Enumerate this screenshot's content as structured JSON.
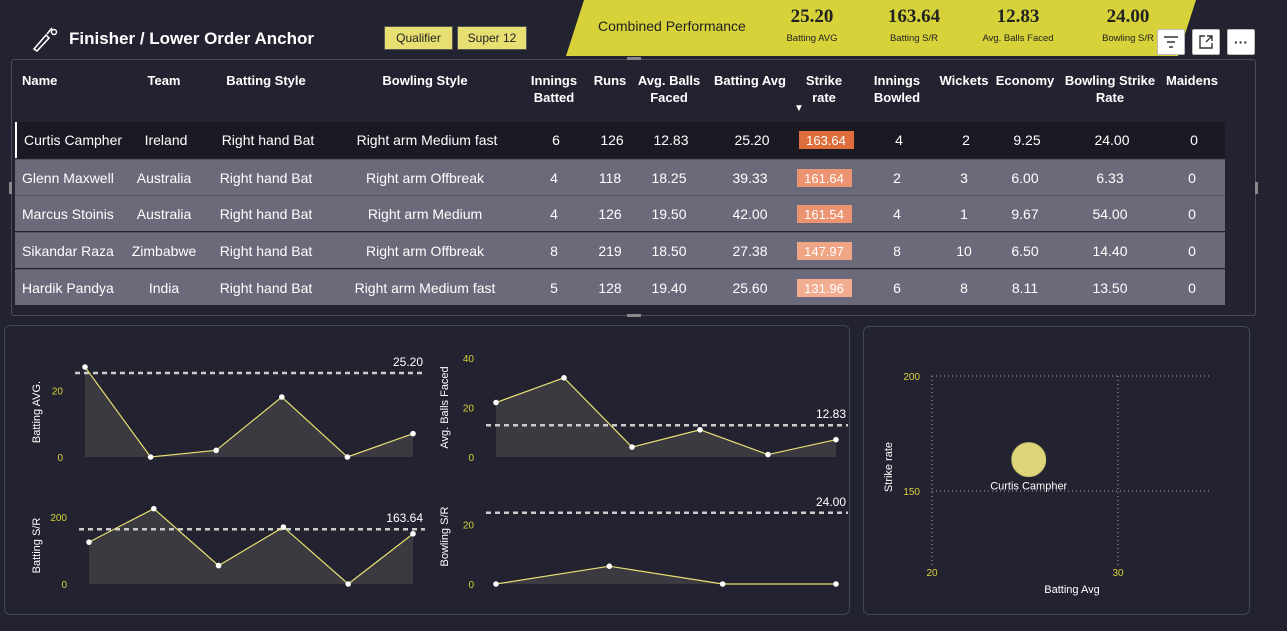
{
  "header": {
    "title": "Finisher / Lower Order Anchor",
    "chips": [
      "Qualifier",
      "Super 12"
    ]
  },
  "combined": {
    "label": "Combined Performance",
    "kpis": [
      {
        "value": "25.20",
        "label": "Batting AVG"
      },
      {
        "value": "163.64",
        "label": "Batting S/R"
      },
      {
        "value": "12.83",
        "label": "Avg. Balls Faced"
      },
      {
        "value": "24.00",
        "label": "Bowling S/R"
      }
    ]
  },
  "toolbar": {
    "icons": [
      "filter-icon",
      "focus-mode-icon",
      "more-options-icon"
    ],
    "more_label": "···"
  },
  "table": {
    "columns": [
      "Name",
      "Team",
      "Batting Style",
      "Bowling Style",
      "Innings Batted",
      "Runs",
      "Avg. Balls Faced",
      "Batting Avg",
      "Strike rate",
      "Innings Bowled",
      "Wickets",
      "Economy",
      "Bowling Strike Rate",
      "Maidens"
    ],
    "sort_indicator": "▼",
    "rows": [
      {
        "cells": [
          "Curtis Campher",
          "Ireland",
          "Right hand Bat",
          "Right arm Medium fast",
          "6",
          "126",
          "12.83",
          "25.20",
          "163.64",
          "4",
          "2",
          "9.25",
          "24.00",
          "0"
        ],
        "strike_color": "#dd6d3b"
      },
      {
        "cells": [
          "Glenn Maxwell",
          "Australia",
          "Right hand Bat",
          "Right arm Offbreak",
          "4",
          "118",
          "18.25",
          "39.33",
          "161.64",
          "2",
          "3",
          "6.00",
          "6.33",
          "0"
        ],
        "strike_color": "#ec9472"
      },
      {
        "cells": [
          "Marcus Stoinis",
          "Australia",
          "Right hand Bat",
          "Right arm Medium",
          "4",
          "126",
          "19.50",
          "42.00",
          "161.54",
          "4",
          "1",
          "9.67",
          "54.00",
          "0"
        ],
        "strike_color": "#ec9472"
      },
      {
        "cells": [
          "Sikandar Raza",
          "Zimbabwe",
          "Right hand Bat",
          "Right arm Offbreak",
          "8",
          "219",
          "18.50",
          "27.38",
          "147.97",
          "8",
          "10",
          "6.50",
          "14.40",
          "0"
        ],
        "strike_color": "#f0a585"
      },
      {
        "cells": [
          "Hardik Pandya",
          "India",
          "Right hand Bat",
          "Right arm Medium fast",
          "5",
          "128",
          "19.40",
          "25.60",
          "131.96",
          "6",
          "8",
          "8.11",
          "13.50",
          "0"
        ],
        "strike_color": "#f2ad90"
      }
    ]
  },
  "chart_data": [
    {
      "type": "area",
      "ylabel": "Batting AVG.",
      "ylim": [
        0,
        27
      ],
      "yticks": [
        0,
        20
      ],
      "values": [
        27,
        0,
        2,
        18,
        0,
        7
      ],
      "reference": {
        "value": 25.2,
        "label": "25.20"
      }
    },
    {
      "type": "area",
      "ylabel": "Avg. Balls Faced",
      "ylim": [
        0,
        40
      ],
      "yticks": [
        0,
        20,
        40
      ],
      "values": [
        22,
        32,
        4,
        11,
        1,
        7
      ],
      "reference": {
        "value": 12.83,
        "label": "12.83"
      }
    },
    {
      "type": "area",
      "ylabel": "Batting S/R",
      "ylim": [
        0,
        230
      ],
      "yticks": [
        0,
        200
      ],
      "values": [
        125,
        225,
        55,
        170,
        0,
        150
      ],
      "reference": {
        "value": 163.64,
        "label": "163.64"
      }
    },
    {
      "type": "area",
      "ylabel": "Bowling S/R",
      "ylim": [
        0,
        32
      ],
      "yticks": [
        0,
        20
      ],
      "values": [
        0,
        6,
        0,
        0
      ],
      "reference": {
        "value": 24,
        "label": "24.00"
      }
    },
    {
      "type": "scatter",
      "xlabel": "Batting Avg",
      "ylabel": "Strike rate",
      "xlim": [
        20,
        30
      ],
      "ylim": [
        140,
        200
      ],
      "xticks": [
        20,
        30
      ],
      "yticks": [
        150,
        200
      ],
      "points": [
        {
          "x": 25.2,
          "y": 163.64,
          "label": "Curtis Campher"
        }
      ],
      "grid": true
    }
  ],
  "colors": {
    "accent": "#d7d23a",
    "line": "#e8df72",
    "row_bg": "#6a6a7a",
    "row_first": "#1a1a24",
    "reference": "#cccccc"
  }
}
